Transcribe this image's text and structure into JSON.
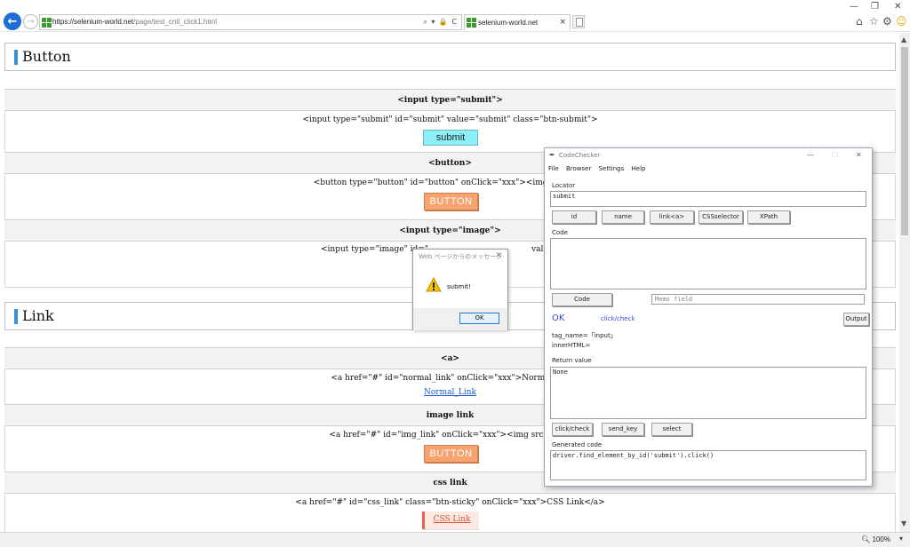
{
  "browser": {
    "url_host": "https://selenium-world.net",
    "url_path": "/page/test_cntl_click1.html",
    "addr_tools": "⌕ ▾ 🔒 C",
    "tab_title": "selenium-world.net",
    "tab_close": "×",
    "window_controls": {
      "minimize": "—",
      "restore": "❐",
      "close": "✕"
    },
    "toolbar_icons": [
      "home-icon",
      "star-icon",
      "gear-icon",
      "smiley-icon"
    ],
    "zoom": "100%"
  },
  "page": {
    "section_button": "Button",
    "section_link": "Link",
    "rows": {
      "submit_head": "<input type=\"submit\">",
      "submit_code": "<input type=\"submit\" id=\"submit\" value=\"submit\" class=\"btn-submit\">",
      "submit_value": "submit",
      "button_head": "<button>",
      "button_code": "<button type=\"button\" id=\"button\" onClick=\"xxx\"><img src=\"xxx",
      "button_label": "BUTTON",
      "image_head": "<input type=\"image\">",
      "image_code_a": "<input type=\"image\" id=\"",
      "image_code_b": "valu",
      "a_head": "<a>",
      "a_code": "<a href=\"#\" id=\"normal_link\" onClick=\"xxx\">Normal_Lin",
      "a_link": "Normal_Link",
      "imglink_head": "image link",
      "imglink_code": "<a href=\"#\" id=\"img_link\" onClick=\"xxx\"><img src=\"xxx\"",
      "imglink_label": "BUTTON",
      "csslink_head": "css link",
      "csslink_code": "<a href=\"#\" id=\"css_link\" class=\"btn-sticky\" onClick=\"xxx\">CSS Link</a>",
      "csslink_label": "CSS Link"
    }
  },
  "alert": {
    "title": "Web ページからのメッセージ",
    "close": "✕",
    "message": "submit!",
    "ok": "OK"
  },
  "codechecker": {
    "title": "CodeChecker",
    "window_controls": {
      "minimize": "—",
      "maximize": "☐",
      "close": "✕"
    },
    "menu": [
      "File",
      "Browser",
      "Settings",
      "Help"
    ],
    "locator_label": "Locator",
    "locator_value": "submit",
    "locator_buttons": [
      "id",
      "name",
      "link<a>",
      "CSSselector",
      "XPath"
    ],
    "code_label": "Code",
    "code_button": "Code",
    "memo_placeholder": "Memo field",
    "status_ok": "OK",
    "status_action": "click/check",
    "output_button": "Output",
    "tag_name": "tag_name=「input」",
    "inner_html": "innerHTML=",
    "return_label": "Return value",
    "return_value": "None",
    "action_buttons": [
      "click/check",
      "send_key",
      "select"
    ],
    "generated_label": "Generated code",
    "generated_code": "driver.find_element_by_id('submit').click()"
  }
}
